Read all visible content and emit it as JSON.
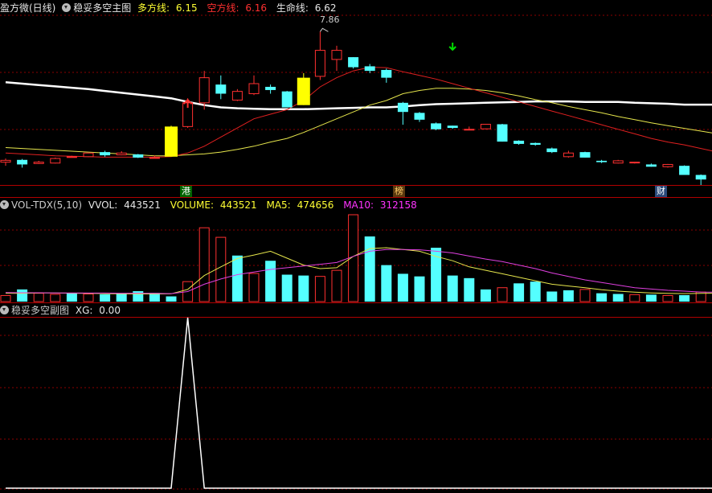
{
  "panel_main": {
    "app_label": "盈方微(日线)",
    "indicator_name": "稳妥多空主图",
    "long_label": "多方线:",
    "long_value": "6.15",
    "short_label": "空方线:",
    "short_value": "6.16",
    "life_label": "生命线:",
    "life_value": "6.62",
    "max_label": "7.86"
  },
  "panel_vol": {
    "name": "VOL-TDX(5,10)",
    "vvol_label": "VVOL:",
    "vvol_value": "443521",
    "volume_label": "VOLUME:",
    "volume_value": "443521",
    "ma5_label": "MA5:",
    "ma5_value": "474656",
    "ma10_label": "MA10:",
    "ma10_value": "312158"
  },
  "panel_sub": {
    "name": "稳妥多空副图",
    "xg_label": "XG:",
    "xg_value": "0.00"
  },
  "badges": {
    "gang": "港",
    "bang": "榜",
    "cai": "财"
  },
  "colors": {
    "up": "#ff3030",
    "down": "#54ffff",
    "signal": "#ffff00",
    "grid": "#8b0000",
    "white": "#ffffff"
  },
  "chart_data": [
    {
      "type": "candlestick",
      "title": "稳妥多空主图",
      "y_range": [
        4.5,
        8.2
      ],
      "candles": [
        {
          "o": 5.0,
          "h": 5.08,
          "l": 4.92,
          "c": 5.04
        },
        {
          "o": 5.05,
          "h": 5.07,
          "l": 4.88,
          "c": 4.95
        },
        {
          "o": 4.97,
          "h": 5.03,
          "l": 4.96,
          "c": 5.0
        },
        {
          "o": 4.98,
          "h": 5.1,
          "l": 4.97,
          "c": 5.08
        },
        {
          "o": 5.12,
          "h": 5.14,
          "l": 5.1,
          "c": 5.12
        },
        {
          "o": 5.12,
          "h": 5.2,
          "l": 5.11,
          "c": 5.2
        },
        {
          "o": 5.22,
          "h": 5.25,
          "l": 5.12,
          "c": 5.15
        },
        {
          "o": 5.16,
          "h": 5.24,
          "l": 5.15,
          "c": 5.2
        },
        {
          "o": 5.17,
          "h": 5.18,
          "l": 5.09,
          "c": 5.1
        },
        {
          "o": 5.1,
          "h": 5.15,
          "l": 5.09,
          "c": 5.1
        },
        {
          "o": 5.12,
          "h": 5.8,
          "l": 5.12,
          "c": 5.78,
          "signal": true
        },
        {
          "o": 5.78,
          "h": 6.4,
          "l": 5.75,
          "c": 6.3
        },
        {
          "o": 6.3,
          "h": 7.0,
          "l": 6.15,
          "c": 6.85
        },
        {
          "o": 6.7,
          "h": 6.9,
          "l": 6.38,
          "c": 6.5
        },
        {
          "o": 6.36,
          "h": 6.6,
          "l": 6.34,
          "c": 6.55
        },
        {
          "o": 6.5,
          "h": 6.9,
          "l": 6.47,
          "c": 6.72
        },
        {
          "o": 6.65,
          "h": 6.7,
          "l": 6.5,
          "c": 6.58
        },
        {
          "o": 6.55,
          "h": 6.56,
          "l": 6.2,
          "c": 6.2
        },
        {
          "o": 6.25,
          "h": 6.95,
          "l": 6.25,
          "c": 6.85,
          "signal": true
        },
        {
          "o": 6.88,
          "h": 7.86,
          "l": 6.8,
          "c": 7.45
        },
        {
          "o": 7.25,
          "h": 7.55,
          "l": 7.0,
          "c": 7.45
        },
        {
          "o": 7.3,
          "h": 7.3,
          "l": 7.05,
          "c": 7.08
        },
        {
          "o": 7.1,
          "h": 7.15,
          "l": 6.95,
          "c": 7.0
        },
        {
          "o": 7.02,
          "h": 7.05,
          "l": 6.74,
          "c": 6.85
        },
        {
          "o": 6.3,
          "h": 6.32,
          "l": 5.82,
          "c": 6.1
        },
        {
          "o": 6.08,
          "h": 6.1,
          "l": 5.88,
          "c": 5.93
        },
        {
          "o": 5.85,
          "h": 5.87,
          "l": 5.7,
          "c": 5.72
        },
        {
          "o": 5.8,
          "h": 5.8,
          "l": 5.73,
          "c": 5.75
        },
        {
          "o": 5.72,
          "h": 5.78,
          "l": 5.7,
          "c": 5.72
        },
        {
          "o": 5.73,
          "h": 5.83,
          "l": 5.72,
          "c": 5.83
        },
        {
          "o": 5.83,
          "h": 5.84,
          "l": 5.45,
          "c": 5.45
        },
        {
          "o": 5.47,
          "h": 5.48,
          "l": 5.38,
          "c": 5.4
        },
        {
          "o": 5.42,
          "h": 5.43,
          "l": 5.36,
          "c": 5.38
        },
        {
          "o": 5.3,
          "h": 5.32,
          "l": 5.2,
          "c": 5.22
        },
        {
          "o": 5.12,
          "h": 5.25,
          "l": 5.1,
          "c": 5.2
        },
        {
          "o": 5.22,
          "h": 5.23,
          "l": 5.1,
          "c": 5.1
        },
        {
          "o": 5.03,
          "h": 5.05,
          "l": 4.98,
          "c": 5.0
        },
        {
          "o": 4.98,
          "h": 5.05,
          "l": 4.97,
          "c": 5.03
        },
        {
          "o": 5.0,
          "h": 5.0,
          "l": 4.97,
          "c": 5.0
        },
        {
          "o": 4.95,
          "h": 4.97,
          "l": 4.9,
          "c": 4.9
        },
        {
          "o": 4.9,
          "h": 4.96,
          "l": 4.88,
          "c": 4.95
        },
        {
          "o": 4.92,
          "h": 4.93,
          "l": 4.72,
          "c": 4.72
        },
        {
          "o": 4.72,
          "h": 4.73,
          "l": 4.5,
          "c": 4.62
        },
        {
          "o": 4.55,
          "h": 4.56,
          "l": 4.38,
          "c": 4.4
        }
      ],
      "series": [
        {
          "values": [
            6.75,
            6.72,
            6.69,
            6.66,
            6.63,
            6.6,
            6.56,
            6.52,
            6.48,
            6.44,
            6.4,
            6.32,
            6.25,
            6.2,
            6.18,
            6.17,
            6.16,
            6.16,
            6.16,
            6.17,
            6.18,
            6.19,
            6.2,
            6.2,
            6.22,
            6.25,
            6.27,
            6.28,
            6.29,
            6.3,
            6.31,
            6.32,
            6.33,
            6.33,
            6.33,
            6.32,
            6.32,
            6.32,
            6.3,
            6.29,
            6.28,
            6.26,
            6.26,
            6.26
          ]
        },
        {
          "values": [
            5.32,
            5.3,
            5.28,
            5.26,
            5.24,
            5.22,
            5.2,
            5.18,
            5.16,
            5.14,
            5.14,
            5.16,
            5.18,
            5.22,
            5.28,
            5.35,
            5.44,
            5.52,
            5.65,
            5.8,
            5.95,
            6.1,
            6.25,
            6.35,
            6.5,
            6.57,
            6.62,
            6.62,
            6.6,
            6.57,
            6.52,
            6.45,
            6.37,
            6.3,
            6.22,
            6.15,
            6.08,
            6.0,
            5.93,
            5.86,
            5.8,
            5.74,
            5.68,
            5.62
          ]
        },
        {
          "values": [
            5.2,
            5.18,
            5.16,
            5.14,
            5.13,
            5.12,
            5.11,
            5.11,
            5.11,
            5.11,
            5.12,
            5.2,
            5.35,
            5.55,
            5.75,
            5.95,
            6.05,
            6.15,
            6.35,
            6.65,
            6.85,
            7.0,
            7.08,
            7.07,
            6.98,
            6.9,
            6.82,
            6.72,
            6.62,
            6.52,
            6.42,
            6.32,
            6.22,
            6.12,
            6.02,
            5.92,
            5.82,
            5.72,
            5.62,
            5.52,
            5.44,
            5.38,
            5.3,
            5.22
          ]
        }
      ]
    },
    {
      "type": "bar",
      "title": "VOL-TDX(5,10)",
      "y_range": [
        0,
        500000
      ],
      "values": [
        35000,
        70000,
        48000,
        42000,
        50000,
        44000,
        42000,
        46000,
        60000,
        50000,
        30000,
        115000,
        425000,
        370000,
        265000,
        162000,
        235000,
        155000,
        150000,
        145000,
        180000,
        500000,
        375000,
        210000,
        160000,
        145000,
        310000,
        150000,
        135000,
        70000,
        80000,
        105000,
        115000,
        58000,
        65000,
        70000,
        48000,
        44000,
        40000,
        40000,
        35000,
        37000,
        55000,
        60000,
        70000
      ],
      "up": [
        true,
        false,
        true,
        true,
        false,
        true,
        false,
        false,
        false,
        false,
        false,
        true,
        true,
        true,
        false,
        true,
        false,
        false,
        false,
        true,
        true,
        true,
        false,
        false,
        false,
        false,
        false,
        false,
        false,
        false,
        true,
        false,
        false,
        false,
        false,
        true,
        false,
        false,
        true,
        false,
        true,
        false,
        true,
        false,
        false
      ],
      "series": [
        {
          "values": [
            48000,
            47000,
            50000,
            50000,
            48000,
            47000,
            46000,
            45000,
            44000,
            44000,
            45000,
            70000,
            150000,
            200000,
            248000,
            268000,
            290000,
            250000,
            210000,
            190000,
            195000,
            260000,
            305000,
            310000,
            300000,
            290000,
            260000,
            235000,
            200000,
            180000,
            160000,
            140000,
            120000,
            100000,
            90000,
            80000,
            68000,
            60000,
            54000,
            50000,
            47000,
            46000,
            47000,
            48000,
            50000
          ]
        },
        {
          "values": [
            52000,
            51000,
            51000,
            50000,
            50000,
            49000,
            49000,
            48000,
            48000,
            47000,
            46000,
            58000,
            100000,
            130000,
            155000,
            170000,
            185000,
            195000,
            205000,
            215000,
            225000,
            260000,
            290000,
            300000,
            300000,
            298000,
            290000,
            280000,
            262000,
            245000,
            230000,
            210000,
            190000,
            165000,
            145000,
            125000,
            110000,
            95000,
            80000,
            72000,
            65000,
            60000,
            55000,
            54000,
            53000
          ]
        }
      ]
    },
    {
      "type": "line",
      "title": "稳妥多空副图",
      "y_range": [
        0,
        1
      ],
      "values": [
        0,
        0,
        0,
        0,
        0,
        0,
        0,
        0,
        0,
        0,
        0,
        1,
        0,
        0,
        0,
        0,
        0,
        0,
        0,
        0,
        0,
        0,
        0,
        0,
        0,
        0,
        0,
        0,
        0,
        0,
        0,
        0,
        0,
        0,
        0,
        0,
        0,
        0,
        0,
        0,
        0,
        0,
        0,
        0
      ]
    }
  ]
}
